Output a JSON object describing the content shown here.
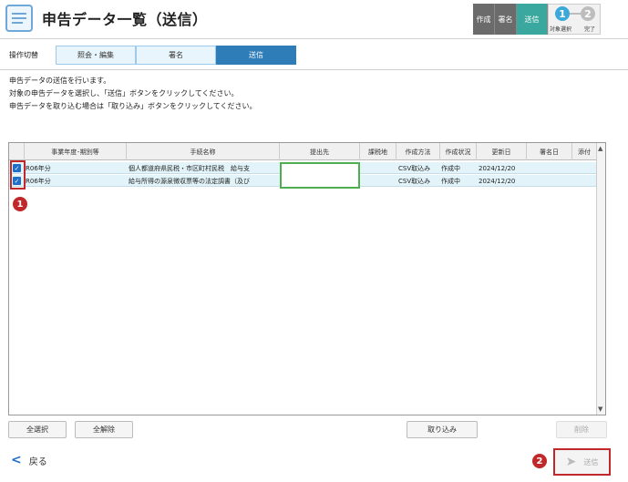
{
  "header": {
    "title": "申告データ一覧（送信）",
    "steps": {
      "tab1": "作成",
      "tab2": "署名",
      "tab3": "送信",
      "flow1_num": "1",
      "flow1_label": "対象選択",
      "flow2_num": "2",
      "flow2_label": "完了"
    }
  },
  "mode": {
    "label": "操作切替",
    "tabs": [
      "照会・編集",
      "署名",
      "送信"
    ],
    "active_tab": "送信"
  },
  "description": [
    "申告データの送信を行います。",
    "対象の申告データを選択し、「送信」ボタンをクリックしてください。",
    "申告データを取り込む場合は「取り込み」ボタンをクリックしてください。"
  ],
  "table": {
    "columns": [
      "事業年度･期別等",
      "手続名称",
      "提出先",
      "課税地",
      "作成方法",
      "作成状況",
      "更新日",
      "署名日",
      "添付"
    ],
    "rows": [
      {
        "checked": true,
        "period": "R06年分",
        "procedure": "個人都道府県民税・市区町村民税　給与支",
        "submit_to": "",
        "tax_place": "",
        "method": "CSV取込み",
        "status": "作成中",
        "updated": "2024/12/20",
        "signed": "",
        "attach": ""
      },
      {
        "checked": true,
        "period": "R06年分",
        "procedure": "給与所得の源泉徴収票等の法定調書（及び",
        "submit_to": "",
        "tax_place": "",
        "method": "CSV取込み",
        "status": "作成中",
        "updated": "2024/12/20",
        "signed": "",
        "attach": ""
      }
    ]
  },
  "markers": {
    "m1": "1",
    "m2": "2"
  },
  "buttons": {
    "select_all": "全選択",
    "deselect_all": "全解除",
    "import": "取り込み",
    "delete": "削除",
    "back": "戻る",
    "send": "送信"
  }
}
